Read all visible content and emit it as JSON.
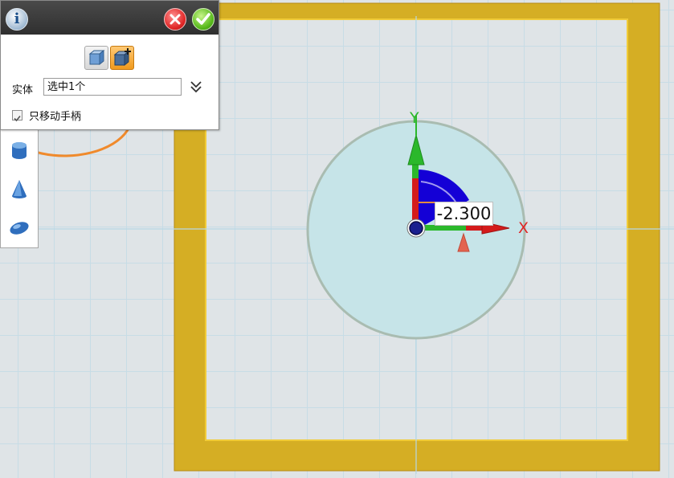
{
  "panel": {
    "entity_label": "实体",
    "entity_value": "选中1个",
    "move_handle_only_label": "只移动手柄",
    "move_handle_only_checked": true
  },
  "gizmo": {
    "dimension_value": "-2.300",
    "x_axis_label": "X",
    "y_axis_label": "Y"
  },
  "icons": {
    "title_bar": [
      "info-icon",
      "close-icon",
      "confirm-icon"
    ],
    "modes": [
      "move-body-icon",
      "move-body-add-icon"
    ],
    "tools": [
      "cylinder-icon",
      "cone-icon",
      "ellipsoid-icon"
    ]
  },
  "colors": {
    "frame": "#d5ae24",
    "circle_fill": "#c6e4e8",
    "circle_stroke": "#a9bcb1",
    "x_axis": "#e02626",
    "y_axis": "#2bb82b",
    "z_axis": "#1400d6",
    "annotation": "#f08a2c"
  }
}
